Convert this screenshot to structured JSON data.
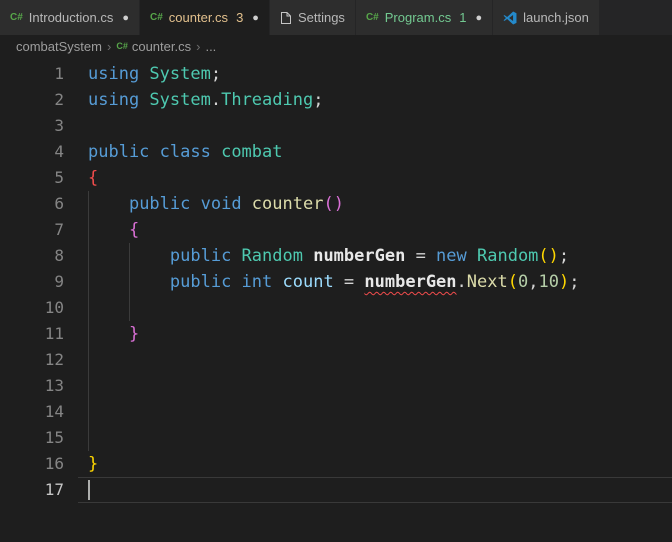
{
  "tabs": {
    "items": [
      {
        "label": "Introduction.cs",
        "icon": "csharp",
        "dirty": true,
        "active": false,
        "state": "plain",
        "badge": ""
      },
      {
        "label": "counter.cs",
        "icon": "csharp",
        "dirty": true,
        "active": true,
        "state": "modified",
        "badge": "3"
      },
      {
        "label": "Settings",
        "icon": "file",
        "dirty": false,
        "active": false,
        "state": "plain",
        "badge": ""
      },
      {
        "label": "Program.cs",
        "icon": "csharp",
        "dirty": true,
        "active": false,
        "state": "added",
        "badge": "1"
      },
      {
        "label": "launch.json",
        "icon": "vscode",
        "dirty": false,
        "active": false,
        "state": "plain",
        "badge": ""
      }
    ]
  },
  "breadcrumb": {
    "items": [
      {
        "label": "combatSystem"
      },
      {
        "label": "counter.cs",
        "icon": "csharp"
      },
      {
        "label": "..."
      }
    ],
    "separator": "›"
  },
  "icons": {
    "csharp_text": "C#",
    "modified_dot": "●"
  },
  "colors": {
    "git_modified": "#e2c08d",
    "git_added": "#73c991",
    "error_red": "#f14c4c",
    "keyword_blue": "#569cd6",
    "type_teal": "#4ec9b0"
  },
  "editor": {
    "lines": [
      {
        "num": "1",
        "tokens": [
          [
            "using ",
            "kw"
          ],
          [
            "System",
            "type"
          ],
          [
            ";",
            "pl"
          ]
        ]
      },
      {
        "num": "2",
        "tokens": [
          [
            "using ",
            "kw"
          ],
          [
            "System",
            "type"
          ],
          [
            ".",
            "pl"
          ],
          [
            "Threading",
            "type"
          ],
          [
            ";",
            "pl"
          ]
        ]
      },
      {
        "num": "3",
        "tokens": []
      },
      {
        "num": "4",
        "tokens": [
          [
            "public ",
            "kw"
          ],
          [
            "class ",
            "kw"
          ],
          [
            "combat",
            "type"
          ]
        ]
      },
      {
        "num": "5",
        "tokens": [
          [
            "{",
            "bRed"
          ]
        ]
      },
      {
        "num": "6",
        "tokens": [
          [
            "    ",
            "pl"
          ],
          [
            "public ",
            "kw"
          ],
          [
            "void ",
            "kw"
          ],
          [
            "counter",
            "fn"
          ],
          [
            "(",
            "bPink"
          ],
          [
            ")",
            "bPink"
          ]
        ]
      },
      {
        "num": "7",
        "tokens": [
          [
            "    ",
            "pl"
          ],
          [
            "{",
            "bPink"
          ]
        ]
      },
      {
        "num": "8",
        "tokens": [
          [
            "        ",
            "pl"
          ],
          [
            "public ",
            "kw"
          ],
          [
            "Random ",
            "type"
          ],
          [
            "numberGen",
            "field"
          ],
          [
            " = ",
            "pl"
          ],
          [
            "new ",
            "kw"
          ],
          [
            "Random",
            "type"
          ],
          [
            "(",
            "bGold"
          ],
          [
            ")",
            "bGold"
          ],
          [
            ";",
            "pl"
          ]
        ]
      },
      {
        "num": "9",
        "tokens": [
          [
            "        ",
            "pl"
          ],
          [
            "public ",
            "kw"
          ],
          [
            "int ",
            "kw"
          ],
          [
            "count",
            "var"
          ],
          [
            " = ",
            "pl"
          ],
          [
            "numberGen",
            "field",
            true
          ],
          [
            ".",
            "pl"
          ],
          [
            "Next",
            "fn"
          ],
          [
            "(",
            "bGold"
          ],
          [
            "0",
            "num"
          ],
          [
            ",",
            "pl"
          ],
          [
            "10",
            "num"
          ],
          [
            ")",
            "bGold"
          ],
          [
            ";",
            "pl"
          ]
        ]
      },
      {
        "num": "10",
        "tokens": []
      },
      {
        "num": "11",
        "tokens": [
          [
            "    ",
            "pl"
          ],
          [
            "}",
            "bPink"
          ]
        ]
      },
      {
        "num": "12",
        "tokens": []
      },
      {
        "num": "13",
        "tokens": []
      },
      {
        "num": "14",
        "tokens": []
      },
      {
        "num": "15",
        "tokens": []
      },
      {
        "num": "16",
        "tokens": [
          [
            "}",
            "bGold"
          ]
        ]
      },
      {
        "num": "17",
        "tokens": [],
        "current": true
      }
    ]
  }
}
